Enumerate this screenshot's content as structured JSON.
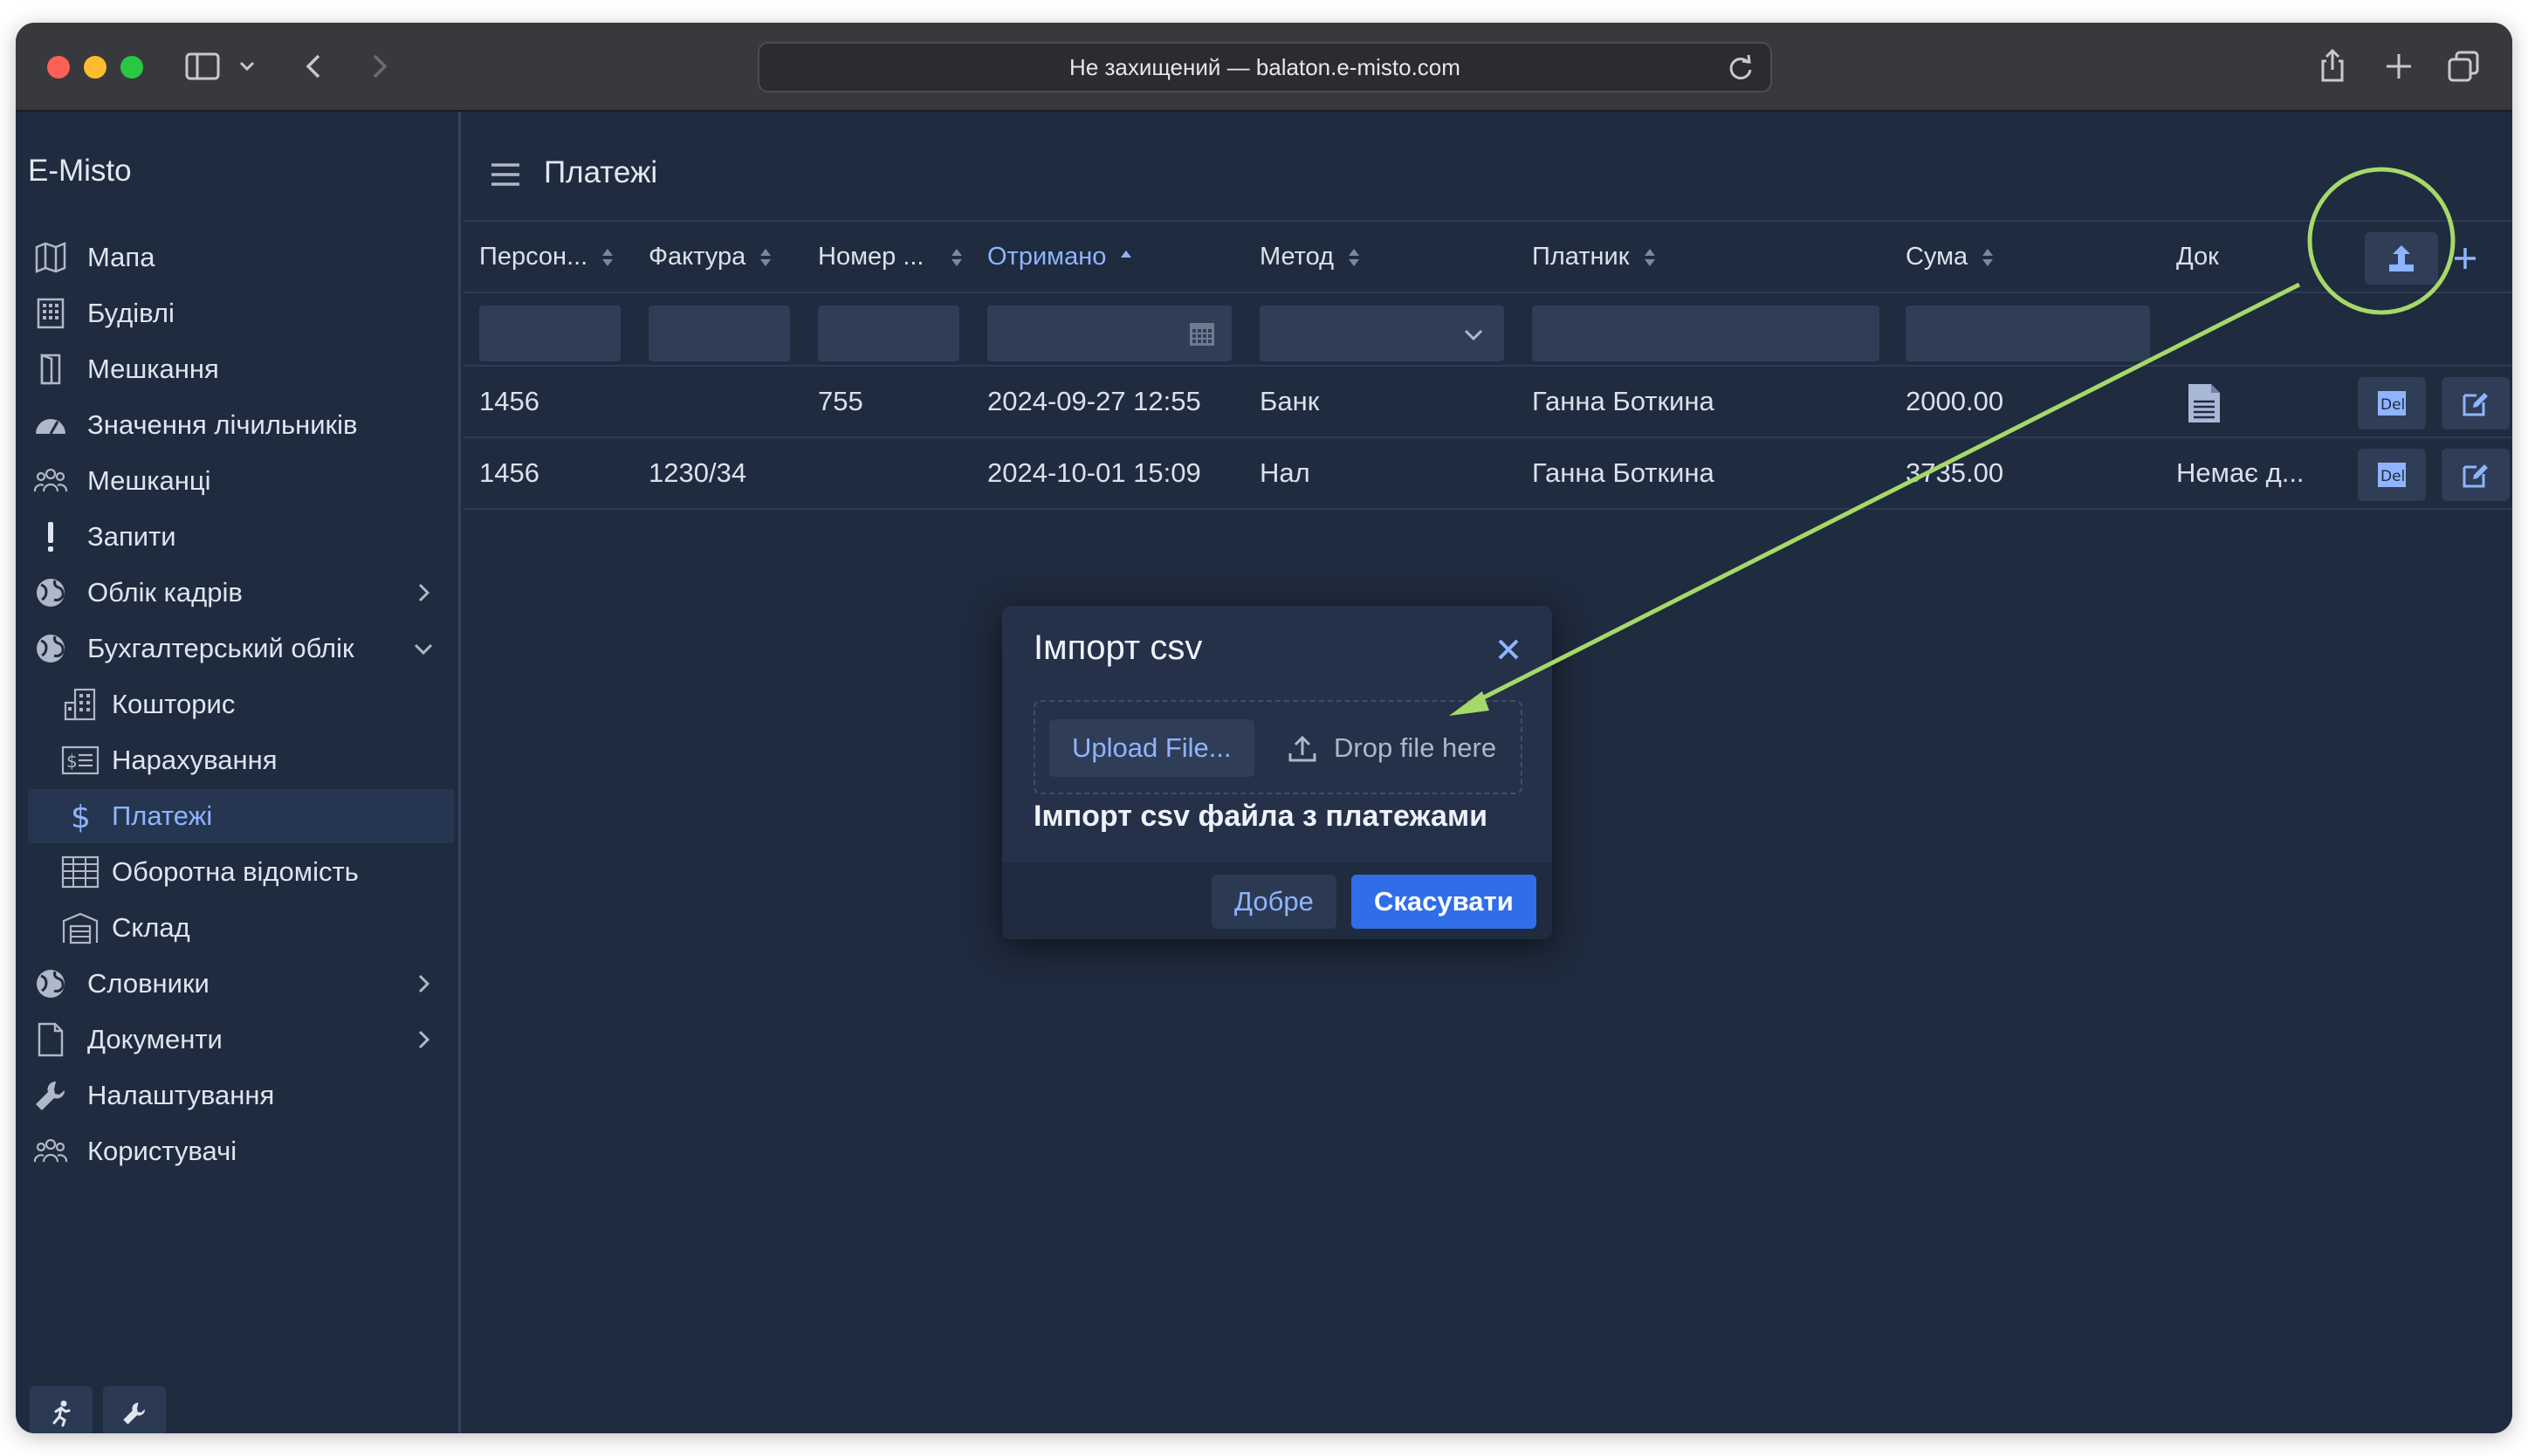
{
  "browser": {
    "address": "Не захищений — balaton.e-misto.com"
  },
  "sidebar": {
    "brand": "E-Misto",
    "items": [
      {
        "label": "Мапа"
      },
      {
        "label": "Будівлі"
      },
      {
        "label": "Мешкання"
      },
      {
        "label": "Значення лічильників"
      },
      {
        "label": "Мешканці"
      },
      {
        "label": "Запити"
      },
      {
        "label": "Облік кадрів"
      },
      {
        "label": "Бухгалтерський облік"
      },
      {
        "label": "Кошторис"
      },
      {
        "label": "Нарахування"
      },
      {
        "label": "Платежі"
      },
      {
        "label": "Оборотна відомість"
      },
      {
        "label": "Склад"
      },
      {
        "label": "Словники"
      },
      {
        "label": "Документи"
      },
      {
        "label": "Налаштування"
      },
      {
        "label": "Користувачі"
      }
    ]
  },
  "main": {
    "title": "Платежі",
    "columns": [
      {
        "label": "Персон..."
      },
      {
        "label": "Фактура"
      },
      {
        "label": "Номер ..."
      },
      {
        "label": "Отримано"
      },
      {
        "label": "Метод"
      },
      {
        "label": "Платник"
      },
      {
        "label": "Сума"
      },
      {
        "label": "Док"
      }
    ],
    "rows": [
      {
        "personal": "1456",
        "invoice": "",
        "number": "755",
        "received": "2024-09-27 12:55",
        "method": "Банк",
        "payer": "Ганна Боткина",
        "sum": "2000.00",
        "doc": ""
      },
      {
        "personal": "1456",
        "invoice": "1230/34",
        "number": "",
        "received": "2024-10-01 15:09",
        "method": "Нал",
        "payer": "Ганна Боткина",
        "sum": "3735.00",
        "doc": "Немає д..."
      }
    ],
    "delete_icon_text": "Del"
  },
  "modal": {
    "title": "Імпорт csv",
    "upload_label": "Upload File...",
    "drop_label": "Drop file here",
    "description": "Імпорт csv файла з платежами",
    "ok_label": "Добре",
    "cancel_label": "Скасувати"
  },
  "colors": {
    "accent": "#8fb4ff",
    "primary_button": "#2f6ee8",
    "annotation": "#a6d86a"
  }
}
